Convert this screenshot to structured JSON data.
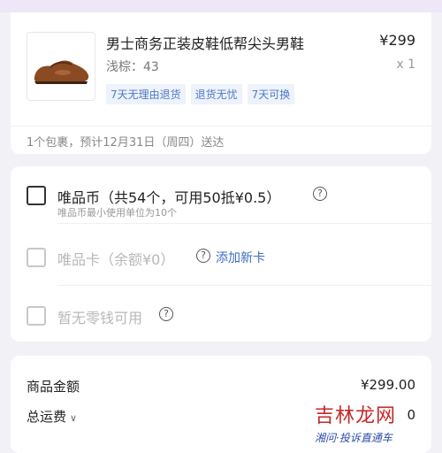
{
  "top_banner": {
    "text": ""
  },
  "product": {
    "name": "男士商务正装皮鞋低帮尖头男鞋",
    "price": "¥299",
    "spec": "浅棕：43",
    "quantity": "x 1",
    "tags": [
      "7天无理由退货",
      "退货无忧",
      "7天可换"
    ]
  },
  "delivery": {
    "text": "1个包裹，预计12月31日（周四）送达"
  },
  "payment": {
    "vip_coin": {
      "label": "唯品币（共54个，可用50抵¥0.5）",
      "note": "唯品币最小使用单位为10个"
    },
    "vip_card": {
      "label": "唯品卡（余额¥0）",
      "add_link": "添加新卡"
    },
    "change": {
      "label": "暂无零钱可用"
    }
  },
  "summary": {
    "goods_amount_label": "商品金额",
    "goods_amount_value": "¥299.00",
    "shipping_label": "总运费",
    "shipping_value": "0"
  },
  "watermark": {
    "main": "吉林龙网",
    "sub": "湘问·投诉直通车"
  },
  "colors": {
    "link": "#3e6cc4",
    "tag_text": "#4f7ac7",
    "tag_bg": "#eef2fb",
    "page_bg": "#f2f2f6"
  },
  "icons": {
    "help": "question-circle-icon",
    "chevron": "chevron-down-icon"
  }
}
